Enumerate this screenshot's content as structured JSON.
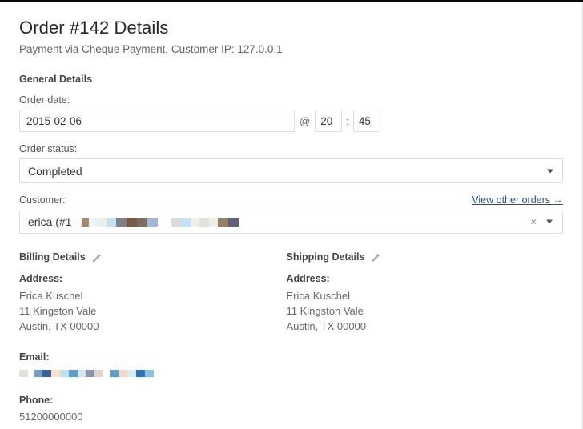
{
  "page": {
    "title": "Order #142 Details",
    "subtitle": "Payment via Cheque Payment. Customer IP: 127.0.0.1"
  },
  "general_details": {
    "heading": "General Details",
    "order_date": {
      "label": "Order date:",
      "value": "2015-02-06",
      "at_separator": "@",
      "hour": "20",
      "colon_separator": ":",
      "minute": "45"
    },
    "order_status": {
      "label": "Order status:",
      "value": "Completed",
      "caret_icon": "chevron-down-icon"
    },
    "customer": {
      "label": "Customer:",
      "view_other_orders_link": "View other orders →",
      "value": "erica (#1 –",
      "clear_icon": "×",
      "caret_icon": "chevron-down-icon",
      "redacted_blocks": [
        {
          "color": "#a08a72",
          "width": 9
        },
        {
          "color": "#e9f5fb",
          "width": 11
        },
        {
          "color": "#eceeeb",
          "width": 11
        },
        {
          "color": "#c7e1f0",
          "width": 12
        },
        {
          "color": "#7b8089",
          "width": 13
        },
        {
          "color": "#7a5a40",
          "width": 13
        },
        {
          "color": "#7d6d62",
          "width": 13
        },
        {
          "color": "#a2b5d2",
          "width": 13
        },
        {
          "color": "#ffffff",
          "width": 17
        },
        {
          "color": "#dedbd9",
          "width": 12
        },
        {
          "color": "#c3e2f5",
          "width": 12
        },
        {
          "color": "#eeeeea",
          "width": 11
        },
        {
          "color": "#dde4dc",
          "width": 12
        },
        {
          "color": "#eeeee6",
          "width": 11
        },
        {
          "color": "#93826a",
          "width": 13
        },
        {
          "color": "#61607f",
          "width": 13
        }
      ]
    }
  },
  "billing": {
    "title": "Billing Details",
    "edit_icon": "pencil-icon",
    "address_label": "Address:",
    "address_lines": [
      "Erica Kuschel",
      "11 Kingston Vale",
      "Austin, TX 00000"
    ]
  },
  "shipping": {
    "title": "Shipping Details",
    "edit_icon": "pencil-icon",
    "address_label": "Address:",
    "address_lines": [
      "Erica Kuschel",
      "11 Kingston Vale",
      "Austin, TX 00000"
    ]
  },
  "contact": {
    "email_label": "Email:",
    "email_redacted_blocks": [
      {
        "color": "#e4e1dd",
        "width": 11
      },
      {
        "color": "#ffffff",
        "width": 8
      },
      {
        "color": "#6f9fc4",
        "width": 10
      },
      {
        "color": "#3f5e9e",
        "width": 11
      },
      {
        "color": "#f6e4cf",
        "width": 11
      },
      {
        "color": "#bfe0ef",
        "width": 11
      },
      {
        "color": "#5d9dc6",
        "width": 11
      },
      {
        "color": "#d4e6ef",
        "width": 10
      },
      {
        "color": "#9095ad",
        "width": 11
      },
      {
        "color": "#ded5cc",
        "width": 10
      },
      {
        "color": "#ffffff",
        "width": 9
      },
      {
        "color": "#5d9dc6",
        "width": 11
      },
      {
        "color": "#f0d8cc",
        "width": 11
      },
      {
        "color": "#d7ecf4",
        "width": 11
      },
      {
        "color": "#2f76ab",
        "width": 11
      },
      {
        "color": "#8cc2dd",
        "width": 11
      },
      {
        "color": "#fbfbf3",
        "width": 8
      }
    ],
    "phone_label": "Phone:",
    "phone_value": "51200000000"
  },
  "colors": {
    "link": "#21547e",
    "heading": "#23282d",
    "body_text": "#666666",
    "border": "#dddddd",
    "top_strip": "#0a0a0a"
  }
}
